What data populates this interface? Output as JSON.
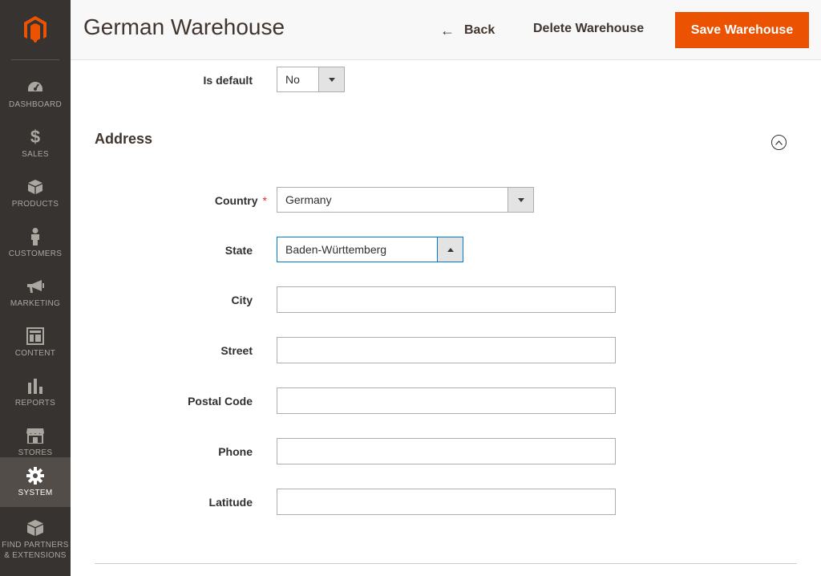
{
  "sidebar": {
    "items": [
      {
        "label": "DASHBOARD",
        "icon": "dashboard-icon"
      },
      {
        "label": "SALES",
        "icon": "dollar-icon"
      },
      {
        "label": "PRODUCTS",
        "icon": "box-icon"
      },
      {
        "label": "CUSTOMERS",
        "icon": "person-icon"
      },
      {
        "label": "MARKETING",
        "icon": "megaphone-icon"
      },
      {
        "label": "CONTENT",
        "icon": "layout-icon"
      },
      {
        "label": "REPORTS",
        "icon": "bar-chart-icon"
      },
      {
        "label": "STORES",
        "icon": "storefront-icon"
      },
      {
        "label": "SYSTEM",
        "icon": "gear-icon"
      },
      {
        "label_line1": "FIND PARTNERS",
        "label_line2": "& EXTENSIONS",
        "icon": "blocks-icon"
      }
    ],
    "active": "SYSTEM"
  },
  "header": {
    "title": "German Warehouse",
    "back_label": "Back",
    "delete_label": "Delete Warehouse",
    "save_label": "Save Warehouse"
  },
  "form": {
    "is_default": {
      "label": "Is default",
      "value": "No"
    },
    "address_section_title": "Address",
    "country": {
      "label": "Country",
      "required_mark": "*",
      "value": "Germany"
    },
    "state": {
      "label": "State",
      "value": "Baden-Württemberg"
    },
    "city": {
      "label": "City",
      "value": ""
    },
    "street": {
      "label": "Street",
      "value": ""
    },
    "postal_code": {
      "label": "Postal Code",
      "value": ""
    },
    "phone": {
      "label": "Phone",
      "value": ""
    },
    "latitude": {
      "label": "Latitude",
      "value": ""
    }
  },
  "colors": {
    "sidebar_bg": "#373330",
    "active_item_bg": "#524d49",
    "save_button": "#eb5202",
    "logo": "#eb5202"
  }
}
